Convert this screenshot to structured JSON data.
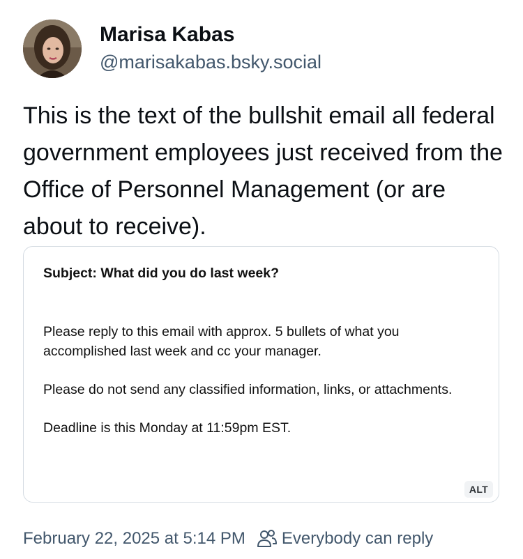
{
  "author": {
    "display_name": "Marisa Kabas",
    "handle": "@marisakabas.bsky.social",
    "avatar_icon": "profile-photo"
  },
  "post": {
    "text": "This is the text of the bullshit email all federal government employees just received from the Office of Personnel Management (or are about to receive)."
  },
  "embed_image": {
    "subject": "Subject: What did you do last week?",
    "paragraph_1": "Please reply to this email with approx. 5 bullets of what you accomplished last week and cc your manager.",
    "paragraph_2": "Please do not send any classified information, links, or attachments.",
    "paragraph_3": "Deadline is this Monday at 11:59pm EST.",
    "alt_badge": "ALT"
  },
  "footer": {
    "timestamp": "February 22, 2025 at 5:14 PM",
    "reply_setting": "Everybody can reply",
    "reply_icon": "people-icon"
  },
  "colors": {
    "text_primary": "#0b0f14",
    "text_secondary": "#42576c",
    "border": "#d4dbe2"
  }
}
